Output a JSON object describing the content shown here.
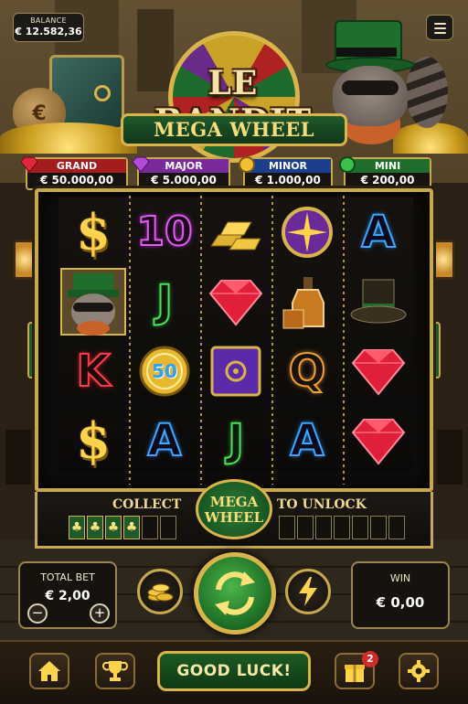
{
  "balance": {
    "label": "BALANCE",
    "value": "€ 12.582,36"
  },
  "logo": {
    "title": "LE BANDIT",
    "subtitle": "MEGA WHEEL"
  },
  "jackpots": [
    {
      "name": "GRAND",
      "value": "€ 50.000,00",
      "color": "#a41c1c",
      "gem": "red-gem"
    },
    {
      "name": "MAJOR",
      "value": "€ 5.000,00",
      "color": "#7a2a9a",
      "gem": "purple-gem"
    },
    {
      "name": "MINOR",
      "value": "€ 1.000,00",
      "color": "#1c3f8c",
      "gem": "gold-coin"
    },
    {
      "name": "MINI",
      "value": "€ 200,00",
      "color": "#1f6e2c",
      "gem": "green-gem"
    }
  ],
  "reels": [
    [
      "dollar",
      "bandit",
      "king",
      "dollar"
    ],
    [
      "ten",
      "jack",
      "coin-50",
      "ace"
    ],
    [
      "gold-bars",
      "ruby",
      "safe",
      "jack"
    ],
    [
      "compass",
      "whiskey",
      "queen",
      "ace"
    ],
    [
      "ace",
      "top-hat",
      "ruby",
      "ruby"
    ]
  ],
  "symbol_text": {
    "dollar": "$",
    "king": "K",
    "ten": "10",
    "jack": "J",
    "ace": "A",
    "queen": "Q",
    "coin-50": "50"
  },
  "collect": {
    "left_label": "COLLECT",
    "right_label": "TO UNLOCK",
    "collected": 4,
    "total": 6,
    "right_slots": 7,
    "clover": "♣"
  },
  "mega_badge": {
    "line1": "MEGA",
    "line2": "WHEEL"
  },
  "total_bet": {
    "label": "TOTAL BET",
    "value": "€ 2,00",
    "minus": "−",
    "plus": "+"
  },
  "win": {
    "label": "WIN",
    "value": "€ 0,00"
  },
  "bottom": {
    "good_luck": "GOOD LUCK!",
    "gift_badge": "2"
  },
  "colors": {
    "gold": "#d9b44a",
    "green": "#1f6e2c",
    "red": "#c81f2a"
  }
}
